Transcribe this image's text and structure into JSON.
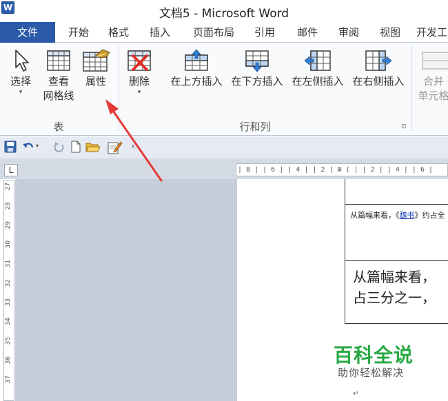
{
  "title": {
    "logo_letter": "W",
    "text": "文档5 - Microsoft Word"
  },
  "tabs": [
    "文件",
    "开始",
    "格式",
    "插入",
    "页面布局",
    "引用",
    "邮件",
    "审阅",
    "视图",
    "开发工"
  ],
  "ribbon": {
    "select": {
      "label": "选择",
      "icon": "cursor-icon"
    },
    "gridlines": {
      "label1": "查看",
      "label2": "网格线",
      "icon": "grid-icon"
    },
    "properties": {
      "label": "属性",
      "icon": "table-properties-icon"
    },
    "delete": {
      "label": "删除",
      "icon": "delete-table-icon"
    },
    "insert_above": {
      "label": "在上方插入"
    },
    "insert_below": {
      "label": "在下方插入"
    },
    "insert_left": {
      "label": "在左侧插入"
    },
    "insert_right": {
      "label": "在右侧插入"
    },
    "merge": {
      "label1": "合并",
      "label2": "单元格"
    },
    "group_table": "表",
    "group_rows_cols": "行和列",
    "launcher": "⊡"
  },
  "rulers": {
    "corner": "L",
    "horizontal": "| 8 |  | 6 |  | 4 |  | 2 |  ⊞ ( |  | 2 |  | 4 |  | 6 |",
    "vertical": [
      "27",
      "28",
      "29",
      "30",
      "31",
      "32",
      "33",
      "34",
      "35",
      "36",
      "37"
    ]
  },
  "document": {
    "small_line_prefix": "从篇幅来看，《",
    "small_line_link": "魏书",
    "small_line_suffix": "》约占全",
    "line1": "从篇幅来看，",
    "line2": "占三分之一，",
    "para_mark": "↵"
  },
  "watermark": {
    "main": "百科全说",
    "sub": "助你轻松解决"
  },
  "colors": {
    "file_tab": "#2a5aa8",
    "arrow": "#e53935",
    "watermark": "#27a844"
  }
}
